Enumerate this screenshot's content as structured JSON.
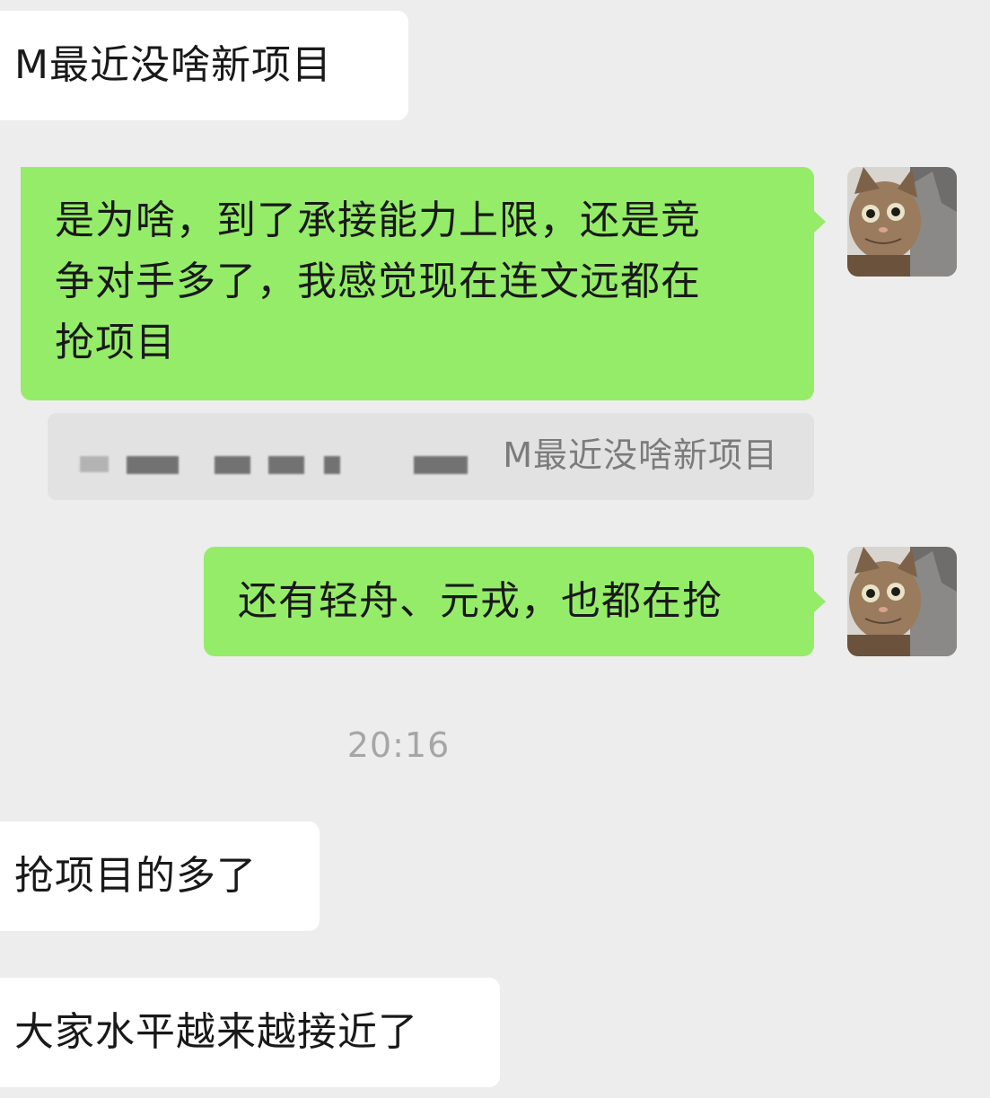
{
  "messages": [
    {
      "side": "in",
      "text": "M最近没啥新项目"
    },
    {
      "side": "out",
      "lines": [
        "是为啥，到了承接能力上限，还是竞",
        "争对手多了，我感觉现在连文远都在",
        "抢项目"
      ]
    },
    {
      "side": "out",
      "text": "还有轻舟、元戎，也都在抢"
    },
    {
      "side": "in",
      "text": "抢项目的多了"
    },
    {
      "side": "in",
      "text": "大家水平越来越接近了"
    }
  ],
  "quote": {
    "sender_redacted": "[redacted]",
    "text": "M最近没啥新项目"
  },
  "timestamp": "20:16",
  "colors": {
    "background": "#ededed",
    "incoming_bubble": "#ffffff",
    "outgoing_bubble": "#95ec69",
    "quote_bg": "#e2e2e2",
    "timestamp": "#a6a6a6"
  },
  "avatar": {
    "description_icon": "cat-avatar-icon"
  }
}
